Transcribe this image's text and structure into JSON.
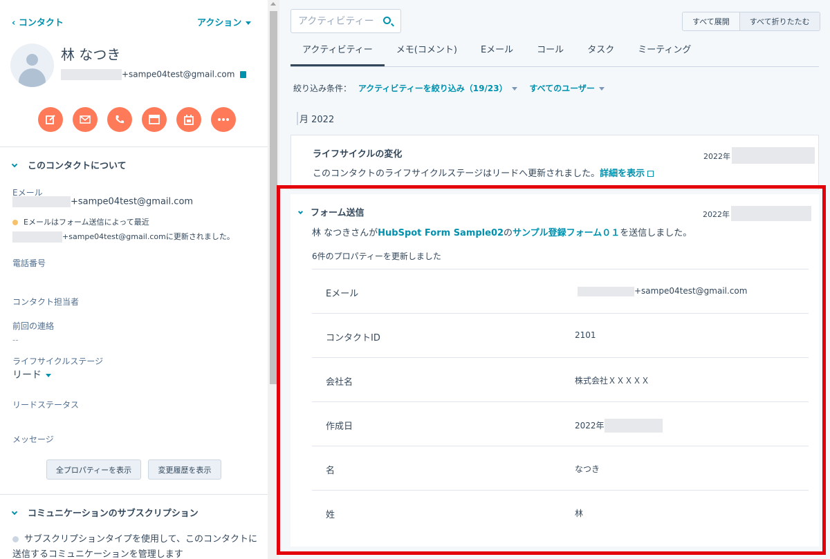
{
  "left": {
    "back_label": "‹ コンタクト",
    "action_label": "アクション",
    "name": "林 なつき",
    "email_suffix": "+sampe04test@gmail.com",
    "action_icons": [
      "edit-icon",
      "email-icon",
      "phone-icon",
      "meeting-icon",
      "calendar-icon",
      "more-icon"
    ],
    "about_title": "このコンタクトについて",
    "email_label": "Eメール",
    "email_value": "+sampe04test@gmail.com",
    "email_note": "Eメールはフォーム送信によって最近",
    "email_note2": "+sampe04test@gmail.comに更新されました。",
    "phone_label": "電話番号",
    "owner_label": "コンタクト担当者",
    "last_contact_label": "前回の連絡",
    "last_contact_value": "--",
    "lifecycle_label": "ライフサイクルステージ",
    "lifecycle_value": "リード",
    "lead_status_label": "リードステータス",
    "message_label": "メッセージ",
    "all_props_button": "全プロパティーを表示",
    "history_button": "変更履歴を表示",
    "subs_title": "コミュニケーションのサブスクリプション",
    "subs_text1": "サブスクリプションタイプを使用して、このコンタクトに",
    "subs_text2": "送信するコミュニケーションを管理します"
  },
  "right": {
    "search_placeholder": "アクティビティー",
    "expand_all": "すべて展開",
    "collapse_all": "すべて折りたたむ",
    "tabs": [
      "アクティビティー",
      "メモ(コメント)",
      "Eメール",
      "コール",
      "タスク",
      "ミーティング"
    ],
    "filter_label": "絞り込み条件：",
    "filter_activity": "アクティビティーを絞り込み（19/23）",
    "filter_users": "すべてのユーザー",
    "month": "月 2022",
    "card1_title": "ライフサイクルの変化",
    "card1_date": "2022年",
    "card1_text": "このコンタクトのライフサイクルステージはリードへ更新されました。",
    "card1_link": "詳細を表示",
    "card2_title": "フォーム送信",
    "card2_date": "2022年",
    "card2_text_a": "林 なつきさんが",
    "card2_text_link1": "HubSpot Form Sample02",
    "card2_text_b": "の",
    "card2_text_link2": "サンプル登録フォーム０１",
    "card2_text_c": "を送信しました。",
    "card2_sub": "6件のプロパティーを更新しました",
    "props": [
      {
        "k": "Eメール",
        "v": "+sampe04test@gmail.com"
      },
      {
        "k": "コンタクトID",
        "v": "2101"
      },
      {
        "k": "会社名",
        "v": "株式会社ＸＸＸＸＸ"
      },
      {
        "k": "作成日",
        "v": "2022年"
      },
      {
        "k": "名",
        "v": "なつき"
      },
      {
        "k": "姓",
        "v": "林"
      }
    ]
  },
  "colors": {
    "accent": "#0091ae",
    "orange": "#ff7a59",
    "highlight": "#e3000b"
  }
}
